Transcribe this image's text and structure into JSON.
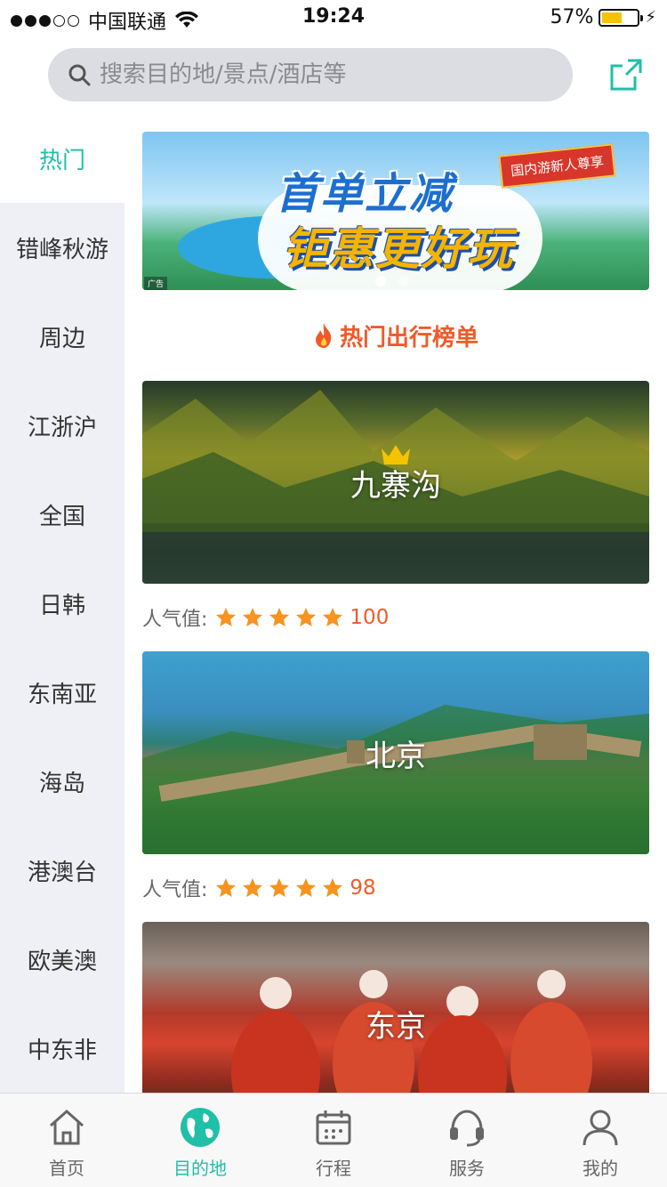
{
  "status_bar": {
    "carrier": "中国联通",
    "time": "19:24",
    "battery": "57%",
    "battery_level": 0.57
  },
  "search": {
    "placeholder": "搜索目的地/景点/酒店等",
    "icon": "search-icon"
  },
  "header": {
    "share_icon": "share-icon"
  },
  "sidebar": {
    "items": [
      {
        "label": "热门",
        "active": true
      },
      {
        "label": "错峰秋游"
      },
      {
        "label": "周边"
      },
      {
        "label": "江浙沪"
      },
      {
        "label": "全国"
      },
      {
        "label": "日韩"
      },
      {
        "label": "东南亚"
      },
      {
        "label": "海岛"
      },
      {
        "label": "港澳台"
      },
      {
        "label": "欧美澳"
      },
      {
        "label": "中东非"
      }
    ]
  },
  "banner": {
    "title_line1": "首单立减",
    "title_line2": "钜惠更好玩",
    "ribbon": "国内游新人尊享",
    "ad_tag": "广告",
    "page_count": 2,
    "active_page": 1
  },
  "section": {
    "title": "热门出行榜单"
  },
  "destinations": [
    {
      "name": "九寨沟",
      "rating_label": "人气值:",
      "stars": 5,
      "score": "100",
      "crown": true
    },
    {
      "name": "北京",
      "rating_label": "人气值:",
      "stars": 5,
      "score": "98"
    },
    {
      "name": "东京"
    }
  ],
  "tab_bar": {
    "tabs": [
      {
        "label": "首页",
        "icon": "home-icon"
      },
      {
        "label": "目的地",
        "icon": "globe-icon",
        "active": true
      },
      {
        "label": "行程",
        "icon": "calendar-icon"
      },
      {
        "label": "服务",
        "icon": "headset-icon"
      },
      {
        "label": "我的",
        "icon": "user-icon"
      }
    ]
  },
  "colors": {
    "accent": "#1fbfa8",
    "highlight": "#f05a28",
    "star": "#f7931e"
  }
}
